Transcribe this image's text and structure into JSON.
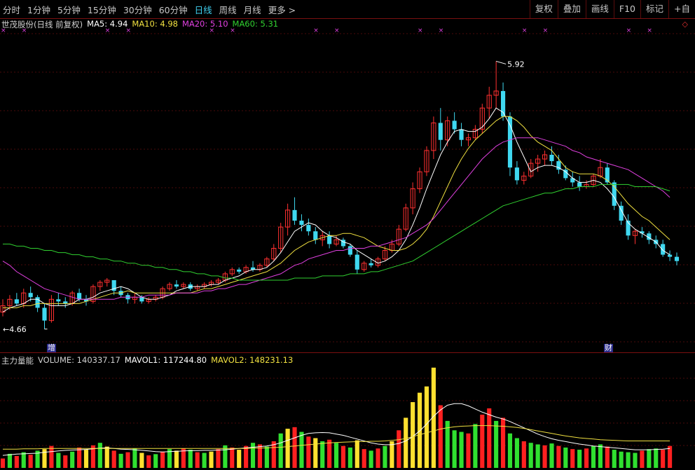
{
  "toolbar": {
    "periods": [
      "分时",
      "1分钟",
      "5分钟",
      "15分钟",
      "30分钟",
      "60分钟",
      "日线",
      "周线",
      "月线",
      "更多 >"
    ],
    "active_period": "日线",
    "right_buttons": [
      "复权",
      "叠加",
      "画线",
      "F10",
      "标记",
      "+自"
    ]
  },
  "header": {
    "title": "世茂股份(日线 前复权)",
    "ma5": "MA5: 4.94",
    "ma10": "MA10: 4.98",
    "ma20": "MA20: 5.10",
    "ma60": "MA60: 5.31"
  },
  "volume_header": {
    "title": "主力量能",
    "volume": "VOLUME: 140337.17",
    "mavol1": "MAVOL1: 117244.80",
    "mavol2": "MAVOL2: 148231.13"
  },
  "annotations": {
    "high_label": "5.92",
    "low_label": "4.66",
    "badge_left": "增",
    "badge_right": "财"
  },
  "colors": {
    "up": "#ff3030",
    "down": "#3fd8f0",
    "ma5": "#ffffff",
    "ma10": "#f0e040",
    "ma20": "#e040e0",
    "ma60": "#30d030",
    "vol_green": "#30e030",
    "vol_red": "#ff2020",
    "vol_yellow": "#ffe030"
  },
  "chart_data": {
    "type": "candlestick",
    "title": "世茂股份(日线 前复权)",
    "price_range": [
      4.6,
      6.05
    ],
    "marked_high": 5.92,
    "marked_low": 4.66,
    "ohlc": [
      [
        4.74,
        4.8,
        4.72,
        4.77
      ],
      [
        4.77,
        4.82,
        4.75,
        4.8
      ],
      [
        4.8,
        4.83,
        4.77,
        4.78
      ],
      [
        4.78,
        4.85,
        4.76,
        4.83
      ],
      [
        4.83,
        4.86,
        4.79,
        4.81
      ],
      [
        4.81,
        4.82,
        4.74,
        4.76
      ],
      [
        4.76,
        4.78,
        4.66,
        4.7
      ],
      [
        4.7,
        4.82,
        4.69,
        4.8
      ],
      [
        4.8,
        4.83,
        4.77,
        4.79
      ],
      [
        4.79,
        4.81,
        4.76,
        4.78
      ],
      [
        4.78,
        4.84,
        4.77,
        4.83
      ],
      [
        4.83,
        4.85,
        4.79,
        4.8
      ],
      [
        4.8,
        4.82,
        4.77,
        4.79
      ],
      [
        4.79,
        4.87,
        4.78,
        4.86
      ],
      [
        4.86,
        4.89,
        4.84,
        4.88
      ],
      [
        4.88,
        4.9,
        4.86,
        4.89
      ],
      [
        4.89,
        4.89,
        4.82,
        4.84
      ],
      [
        4.84,
        4.86,
        4.81,
        4.82
      ],
      [
        4.82,
        4.83,
        4.78,
        4.8
      ],
      [
        4.8,
        4.83,
        4.78,
        4.81
      ],
      [
        4.81,
        4.82,
        4.78,
        4.79
      ],
      [
        4.79,
        4.81,
        4.78,
        4.8
      ],
      [
        4.8,
        4.82,
        4.79,
        4.81
      ],
      [
        4.81,
        4.86,
        4.8,
        4.85
      ],
      [
        4.85,
        4.88,
        4.84,
        4.87
      ],
      [
        4.87,
        4.89,
        4.85,
        4.86
      ],
      [
        4.86,
        4.88,
        4.85,
        4.87
      ],
      [
        4.87,
        4.88,
        4.84,
        4.85
      ],
      [
        4.85,
        4.87,
        4.84,
        4.86
      ],
      [
        4.86,
        4.88,
        4.85,
        4.87
      ],
      [
        4.87,
        4.89,
        4.86,
        4.88
      ],
      [
        4.88,
        4.9,
        4.87,
        4.89
      ],
      [
        4.89,
        4.93,
        4.88,
        4.92
      ],
      [
        4.92,
        4.95,
        4.91,
        4.94
      ],
      [
        4.94,
        4.95,
        4.92,
        4.93
      ],
      [
        4.93,
        4.96,
        4.92,
        4.95
      ],
      [
        4.95,
        4.98,
        4.93,
        4.94
      ],
      [
        4.94,
        4.97,
        4.93,
        4.96
      ],
      [
        4.96,
        5.0,
        4.95,
        4.99
      ],
      [
        4.99,
        5.06,
        4.98,
        5.04
      ],
      [
        5.04,
        5.16,
        5.02,
        5.14
      ],
      [
        5.14,
        5.25,
        5.1,
        5.22
      ],
      [
        5.22,
        5.28,
        5.15,
        5.17
      ],
      [
        5.17,
        5.2,
        5.12,
        5.15
      ],
      [
        5.15,
        5.18,
        5.1,
        5.12
      ],
      [
        5.12,
        5.14,
        5.06,
        5.08
      ],
      [
        5.08,
        5.12,
        5.05,
        5.1
      ],
      [
        5.1,
        5.12,
        5.04,
        5.06
      ],
      [
        5.06,
        5.1,
        5.05,
        5.08
      ],
      [
        5.08,
        5.09,
        5.04,
        5.05
      ],
      [
        5.05,
        5.06,
        5.0,
        5.01
      ],
      [
        5.01,
        5.03,
        4.92,
        4.94
      ],
      [
        4.94,
        4.98,
        4.93,
        4.97
      ],
      [
        4.97,
        4.99,
        4.95,
        4.96
      ],
      [
        4.96,
        5.0,
        4.95,
        4.99
      ],
      [
        4.99,
        5.05,
        4.98,
        5.03
      ],
      [
        5.03,
        5.08,
        5.02,
        5.06
      ],
      [
        5.06,
        5.15,
        5.05,
        5.13
      ],
      [
        5.13,
        5.25,
        5.12,
        5.23
      ],
      [
        5.23,
        5.35,
        5.2,
        5.32
      ],
      [
        5.32,
        5.42,
        5.3,
        5.4
      ],
      [
        5.4,
        5.52,
        5.38,
        5.5
      ],
      [
        5.5,
        5.66,
        5.46,
        5.63
      ],
      [
        5.63,
        5.7,
        5.5,
        5.55
      ],
      [
        5.55,
        5.66,
        5.52,
        5.64
      ],
      [
        5.64,
        5.68,
        5.58,
        5.6
      ],
      [
        5.6,
        5.63,
        5.52,
        5.55
      ],
      [
        5.55,
        5.58,
        5.52,
        5.56
      ],
      [
        5.56,
        5.62,
        5.55,
        5.6
      ],
      [
        5.6,
        5.72,
        5.58,
        5.7
      ],
      [
        5.7,
        5.8,
        5.65,
        5.76
      ],
      [
        5.76,
        5.92,
        5.7,
        5.78
      ],
      [
        5.78,
        5.82,
        5.64,
        5.66
      ],
      [
        5.66,
        5.68,
        5.38,
        5.42
      ],
      [
        5.42,
        5.45,
        5.34,
        5.36
      ],
      [
        5.36,
        5.4,
        5.34,
        5.38
      ],
      [
        5.38,
        5.46,
        5.37,
        5.44
      ],
      [
        5.44,
        5.48,
        5.4,
        5.46
      ],
      [
        5.46,
        5.5,
        5.43,
        5.48
      ],
      [
        5.48,
        5.52,
        5.43,
        5.45
      ],
      [
        5.45,
        5.48,
        5.39,
        5.41
      ],
      [
        5.41,
        5.43,
        5.36,
        5.37
      ],
      [
        5.37,
        5.4,
        5.33,
        5.35
      ],
      [
        5.35,
        5.38,
        5.31,
        5.33
      ],
      [
        5.33,
        5.36,
        5.32,
        5.34
      ],
      [
        5.34,
        5.39,
        5.33,
        5.38
      ],
      [
        5.38,
        5.46,
        5.37,
        5.42
      ],
      [
        5.42,
        5.44,
        5.34,
        5.35
      ],
      [
        5.35,
        5.36,
        5.22,
        5.24
      ],
      [
        5.24,
        5.26,
        5.15,
        5.17
      ],
      [
        5.17,
        5.2,
        5.08,
        5.1
      ],
      [
        5.1,
        5.13,
        5.06,
        5.12
      ],
      [
        5.12,
        5.14,
        5.09,
        5.11
      ],
      [
        5.11,
        5.12,
        5.06,
        5.08
      ],
      [
        5.08,
        5.1,
        5.04,
        5.06
      ],
      [
        5.06,
        5.08,
        5.0,
        5.01
      ],
      [
        5.01,
        5.03,
        4.98,
        5.0
      ],
      [
        5.0,
        5.02,
        4.96,
        4.98
      ]
    ],
    "ma": {
      "MA5": [
        4.74,
        4.76,
        4.77,
        4.78,
        4.8,
        4.8,
        4.78,
        4.77,
        4.77,
        4.77,
        4.78,
        4.8,
        4.8,
        4.81,
        4.83,
        4.84,
        4.85,
        4.86,
        4.85,
        4.83,
        4.81,
        4.8,
        4.8,
        4.81,
        4.82,
        4.84,
        4.85,
        4.86,
        4.86,
        4.86,
        4.87,
        4.87,
        4.89,
        4.9,
        4.91,
        4.93,
        4.94,
        4.94,
        4.95,
        4.98,
        5.02,
        5.07,
        5.12,
        5.14,
        5.16,
        5.15,
        5.12,
        5.1,
        5.09,
        5.07,
        5.06,
        5.03,
        5.01,
        4.99,
        4.97,
        4.98,
        5.0,
        5.03,
        5.08,
        5.15,
        5.23,
        5.32,
        5.4,
        5.48,
        5.54,
        5.59,
        5.6,
        5.59,
        5.59,
        5.61,
        5.65,
        5.7,
        5.68,
        5.62,
        5.54,
        5.47,
        5.4,
        5.42,
        5.43,
        5.43,
        5.42,
        5.4,
        5.37,
        5.35,
        5.35,
        5.36,
        5.35,
        5.32,
        5.28,
        5.22,
        5.16,
        5.13,
        5.11,
        5.09,
        5.07,
        5.03,
        5.01
      ],
      "MA10": [
        4.76,
        4.76,
        4.76,
        4.77,
        4.77,
        4.78,
        4.78,
        4.78,
        4.78,
        4.78,
        4.78,
        4.78,
        4.79,
        4.8,
        4.81,
        4.82,
        4.83,
        4.83,
        4.84,
        4.83,
        4.83,
        4.83,
        4.83,
        4.83,
        4.83,
        4.83,
        4.83,
        4.83,
        4.84,
        4.85,
        4.85,
        4.86,
        4.87,
        4.88,
        4.89,
        4.9,
        4.91,
        4.92,
        4.93,
        4.95,
        4.97,
        5.0,
        5.03,
        5.05,
        5.07,
        5.08,
        5.09,
        5.1,
        5.1,
        5.11,
        5.11,
        5.1,
        5.09,
        5.07,
        5.05,
        5.04,
        5.03,
        5.03,
        5.04,
        5.06,
        5.09,
        5.13,
        5.19,
        5.26,
        5.33,
        5.4,
        5.46,
        5.51,
        5.55,
        5.58,
        5.61,
        5.64,
        5.66,
        5.66,
        5.64,
        5.61,
        5.57,
        5.54,
        5.52,
        5.5,
        5.46,
        5.42,
        5.4,
        5.39,
        5.39,
        5.39,
        5.38,
        5.36,
        5.33,
        5.29,
        5.25,
        5.22,
        5.19,
        5.17,
        5.14,
        5.11,
        5.08
      ],
      "MA20": [
        4.98,
        4.96,
        4.93,
        4.91,
        4.89,
        4.87,
        4.85,
        4.84,
        4.83,
        4.82,
        4.81,
        4.8,
        4.8,
        4.8,
        4.8,
        4.8,
        4.8,
        4.81,
        4.81,
        4.81,
        4.81,
        4.82,
        4.82,
        4.82,
        4.82,
        4.83,
        4.83,
        4.83,
        4.83,
        4.84,
        4.84,
        4.85,
        4.85,
        4.86,
        4.87,
        4.87,
        4.88,
        4.89,
        4.9,
        4.91,
        4.92,
        4.94,
        4.96,
        4.97,
        4.99,
        5.0,
        5.01,
        5.02,
        5.03,
        5.03,
        5.04,
        5.04,
        5.04,
        5.05,
        5.05,
        5.06,
        5.07,
        5.08,
        5.09,
        5.11,
        5.13,
        5.15,
        5.18,
        5.22,
        5.26,
        5.3,
        5.34,
        5.38,
        5.42,
        5.46,
        5.49,
        5.52,
        5.54,
        5.55,
        5.56,
        5.56,
        5.56,
        5.56,
        5.55,
        5.54,
        5.53,
        5.52,
        5.5,
        5.49,
        5.47,
        5.46,
        5.45,
        5.44,
        5.43,
        5.42,
        5.41,
        5.39,
        5.37,
        5.35,
        5.33,
        5.31,
        5.28
      ],
      "MA60": [
        5.06,
        5.06,
        5.05,
        5.05,
        5.04,
        5.04,
        5.03,
        5.03,
        5.02,
        5.02,
        5.01,
        5.01,
        5.0,
        5.0,
        4.99,
        4.99,
        4.98,
        4.98,
        4.97,
        4.97,
        4.96,
        4.96,
        4.95,
        4.95,
        4.94,
        4.94,
        4.93,
        4.93,
        4.92,
        4.92,
        4.91,
        4.91,
        4.9,
        4.9,
        4.89,
        4.89,
        4.89,
        4.89,
        4.89,
        4.89,
        4.89,
        4.89,
        4.9,
        4.9,
        4.9,
        4.9,
        4.91,
        4.91,
        4.91,
        4.91,
        4.92,
        4.92,
        4.92,
        4.93,
        4.93,
        4.94,
        4.95,
        4.96,
        4.97,
        4.98,
        5.0,
        5.02,
        5.04,
        5.06,
        5.08,
        5.1,
        5.12,
        5.14,
        5.16,
        5.18,
        5.2,
        5.22,
        5.24,
        5.25,
        5.26,
        5.27,
        5.28,
        5.29,
        5.3,
        5.3,
        5.31,
        5.32,
        5.32,
        5.33,
        5.33,
        5.33,
        5.34,
        5.34,
        5.34,
        5.34,
        5.34,
        5.33,
        5.33,
        5.33,
        5.33,
        5.32,
        5.31
      ]
    },
    "volume": {
      "values": [
        30,
        45,
        38,
        50,
        42,
        55,
        60,
        70,
        48,
        40,
        52,
        65,
        58,
        72,
        80,
        68,
        55,
        45,
        50,
        62,
        48,
        40,
        44,
        52,
        60,
        55,
        62,
        58,
        50,
        48,
        52,
        60,
        72,
        65,
        58,
        70,
        80,
        75,
        68,
        85,
        110,
        125,
        130,
        115,
        100,
        95,
        85,
        90,
        80,
        70,
        65,
        88,
        60,
        55,
        62,
        70,
        85,
        120,
        160,
        210,
        240,
        260,
        320,
        200,
        150,
        120,
        115,
        110,
        140,
        170,
        190,
        150,
        160,
        110,
        95,
        85,
        80,
        75,
        72,
        78,
        70,
        65,
        60,
        58,
        62,
        70,
        75,
        68,
        58,
        52,
        50,
        48,
        55,
        60,
        62,
        58,
        70
      ],
      "colors": [
        "r",
        "g",
        "r",
        "g",
        "r",
        "g",
        "y",
        "r",
        "g",
        "r",
        "g",
        "r",
        "y",
        "r",
        "g",
        "y",
        "r",
        "g",
        "r",
        "g",
        "y",
        "r",
        "g",
        "r",
        "g",
        "y",
        "r",
        "g",
        "r",
        "g",
        "y",
        "r",
        "g",
        "r",
        "y",
        "r",
        "g",
        "r",
        "g",
        "r",
        "g",
        "y",
        "r",
        "g",
        "r",
        "y",
        "g",
        "r",
        "g",
        "r",
        "g",
        "y",
        "r",
        "g",
        "r",
        "g",
        "y",
        "r",
        "y",
        "y",
        "y",
        "y",
        "y",
        "r",
        "g",
        "g",
        "g",
        "r",
        "g",
        "r",
        "r",
        "g",
        "r",
        "g",
        "g",
        "r",
        "g",
        "g",
        "r",
        "g",
        "r",
        "g",
        "r",
        "g",
        "r",
        "g",
        "g",
        "r",
        "g",
        "g",
        "g",
        "g",
        "r",
        "g",
        "g",
        "r",
        "r"
      ],
      "mavol1": [
        40,
        42,
        44,
        45,
        46,
        47,
        50,
        52,
        54,
        56,
        57,
        58,
        59,
        61,
        63,
        64,
        62,
        60,
        59,
        58,
        56,
        54,
        52,
        51,
        52,
        53,
        54,
        55,
        55,
        56,
        56,
        57,
        58,
        60,
        62,
        64,
        66,
        68,
        70,
        74,
        80,
        88,
        96,
        104,
        110,
        112,
        113,
        112,
        108,
        104,
        98,
        92,
        86,
        80,
        76,
        74,
        74,
        78,
        86,
        100,
        118,
        140,
        165,
        185,
        200,
        205,
        205,
        198,
        188,
        178,
        170,
        162,
        156,
        148,
        138,
        128,
        118,
        108,
        100,
        93,
        88,
        84,
        80,
        76,
        73,
        70,
        68,
        66,
        64,
        62,
        60,
        58,
        58,
        58,
        59,
        60,
        62
      ],
      "mavol2": [
        60,
        60,
        60,
        61,
        61,
        61,
        62,
        62,
        62,
        62,
        62,
        62,
        62,
        62,
        62,
        62,
        62,
        62,
        62,
        62,
        62,
        62,
        62,
        62,
        62,
        62,
        62,
        62,
        62,
        62,
        62,
        62,
        62,
        62,
        62,
        62,
        63,
        63,
        64,
        65,
        66,
        68,
        70,
        72,
        74,
        76,
        78,
        80,
        81,
        82,
        83,
        84,
        84,
        85,
        85,
        86,
        88,
        90,
        94,
        100,
        106,
        112,
        118,
        124,
        128,
        131,
        133,
        134,
        135,
        135,
        135,
        134,
        133,
        131,
        129,
        126,
        122,
        118,
        114,
        110,
        106,
        102,
        99,
        96,
        94,
        92,
        90,
        89,
        88,
        87,
        86,
        86,
        86,
        86,
        86,
        86,
        86
      ]
    },
    "legend": [
      "MA5",
      "MA10",
      "MA20",
      "MA60"
    ]
  }
}
